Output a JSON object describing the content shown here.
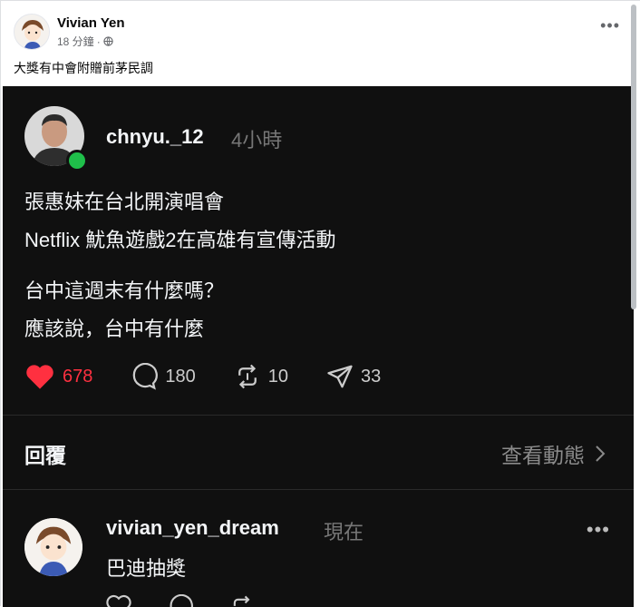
{
  "post": {
    "author": "Vivian Yen",
    "time": "18 分鐘",
    "privacy_icon": "globe-icon",
    "more_icon": "more-dots-icon",
    "text": "大獎有中會附贈前茅民調"
  },
  "threads": {
    "username": "chnyu._12",
    "time": "4小時",
    "body": [
      "張惠妹在台北開演唱會",
      "Netflix 魷魚遊戲2在高雄有宣傳活動",
      "台中這週末有什麼嗎？",
      "應該說，台中有什麼"
    ],
    "likes": "678",
    "comments": "180",
    "reposts": "10",
    "shares": "33",
    "colors": {
      "like": "#ff3040",
      "online": "#1fbf4a",
      "bg": "#101010"
    },
    "replies_title": "回覆",
    "view_activity": "查看動態",
    "reply": {
      "username": "vivian_yen_dream",
      "time": "現在",
      "body": "巴迪抽獎"
    }
  }
}
